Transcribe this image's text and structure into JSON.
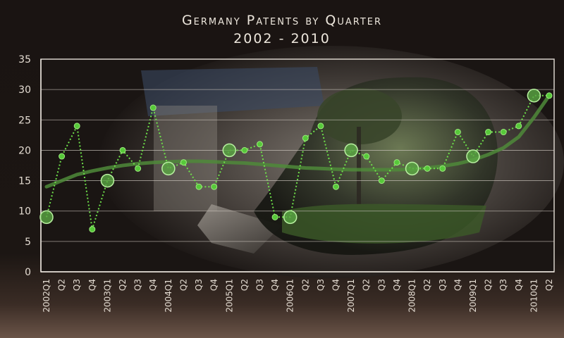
{
  "chart_data": {
    "type": "line",
    "title": "Germany Patents by Quarter",
    "subtitle": "2002 - 2010",
    "xlabel": "",
    "ylabel": "",
    "ylim": [
      0,
      35
    ],
    "yticks": [
      0,
      5,
      10,
      15,
      20,
      25,
      30,
      35
    ],
    "grid": true,
    "categories": [
      "2002Q1",
      "Q2",
      "Q3",
      "Q4",
      "2003Q1",
      "Q2",
      "Q3",
      "Q4",
      "2004Q1",
      "Q2",
      "Q3",
      "Q4",
      "2005Q1",
      "Q2",
      "Q3",
      "Q4",
      "2006Q1",
      "Q2",
      "Q3",
      "Q4",
      "2007Q1",
      "Q2",
      "Q3",
      "Q4",
      "2008Q1",
      "Q2",
      "Q3",
      "Q4",
      "2009Q1",
      "Q2",
      "Q3",
      "Q4",
      "2010Q1",
      "Q2"
    ],
    "series": [
      {
        "values": [
          9,
          19,
          24,
          7,
          15,
          20,
          17,
          27,
          17,
          18,
          14,
          14,
          20,
          20,
          21,
          9,
          9,
          22,
          24,
          14,
          20,
          19,
          15,
          18,
          17,
          17,
          17,
          23,
          19,
          23,
          23,
          24,
          29,
          29
        ]
      }
    ],
    "trend": [
      14,
      15,
      16,
      16.6,
      17.1,
      17.5,
      17.8,
      18,
      18.1,
      18.2,
      18.2,
      18.1,
      18,
      17.9,
      17.7,
      17.5,
      17.3,
      17.1,
      17,
      16.9,
      16.8,
      16.8,
      16.8,
      16.8,
      16.9,
      17.1,
      17.4,
      17.8,
      18.4,
      19.3,
      20.4,
      22.2,
      25.4,
      29
    ]
  },
  "colors": {
    "line": "#6ee04a",
    "marker": "#57c93a",
    "year_marker_fill": "#5aa844",
    "trend": "#4f8a3a",
    "axis_text": "#e4dcd2",
    "gridline": "#cfc8c0"
  }
}
